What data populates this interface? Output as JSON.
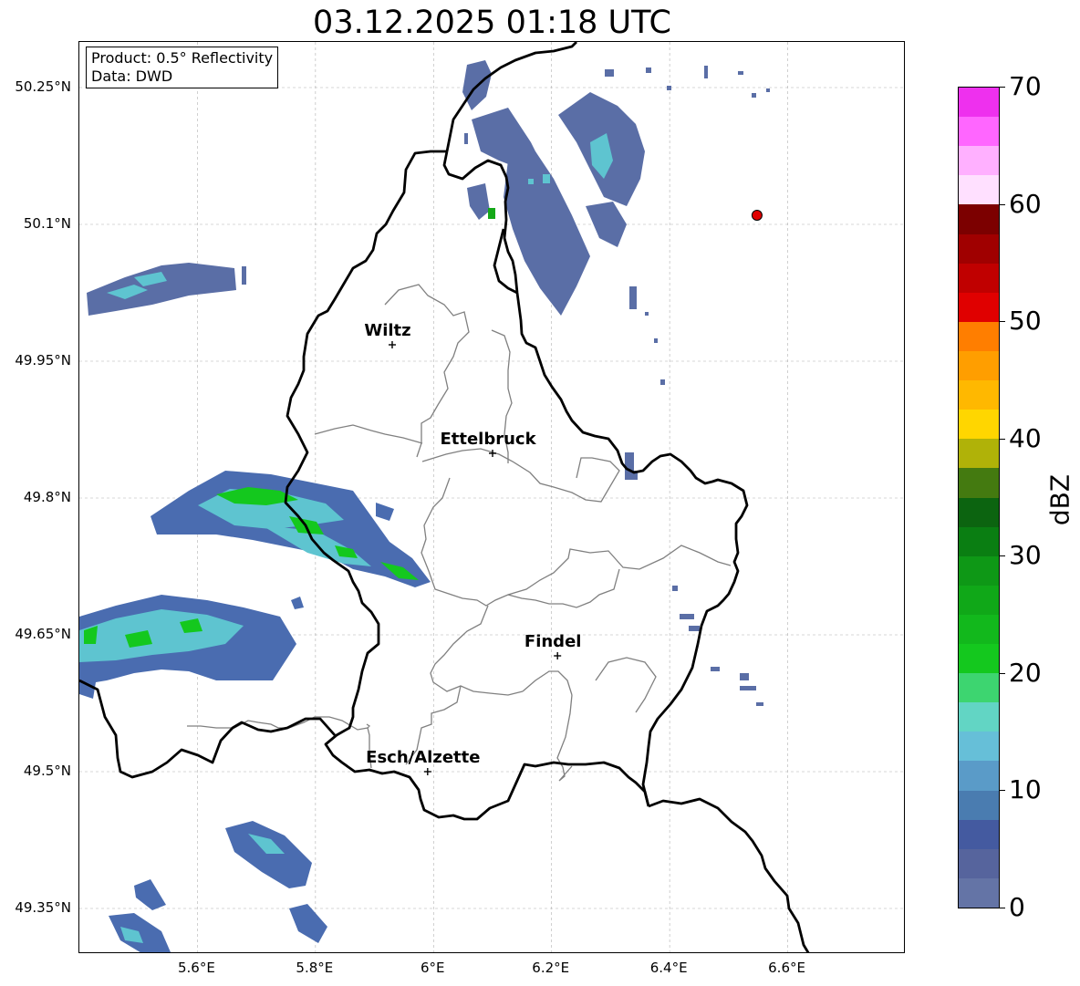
{
  "title": "03.12.2025 01:18 UTC",
  "info": {
    "product": "Product: 0.5° Reflectivity",
    "data": "Data: DWD"
  },
  "map": {
    "lon_range": [
      5.4,
      6.8
    ],
    "lat_range": [
      49.3,
      50.3
    ],
    "lat_ticks": [
      {
        "lat": 50.25,
        "label": "50.25°N"
      },
      {
        "lat": 50.1,
        "label": "50.1°N"
      },
      {
        "lat": 49.95,
        "label": "49.95°N"
      },
      {
        "lat": 49.8,
        "label": "49.8°N"
      },
      {
        "lat": 49.65,
        "label": "49.65°N"
      },
      {
        "lat": 49.5,
        "label": "49.5°N"
      },
      {
        "lat": 49.35,
        "label": "49.35°N"
      }
    ],
    "lon_ticks": [
      {
        "lon": 5.6,
        "label": "5.6°E"
      },
      {
        "lon": 5.8,
        "label": "5.8°E"
      },
      {
        "lon": 6.0,
        "label": "6°E"
      },
      {
        "lon": 6.2,
        "label": "6.2°E"
      },
      {
        "lon": 6.4,
        "label": "6.4°E"
      },
      {
        "lon": 6.6,
        "label": "6.6°E"
      }
    ],
    "cities": [
      {
        "name": "Wiltz",
        "lon": 5.93,
        "lat": 49.968
      },
      {
        "name": "Ettelbruck",
        "lon": 6.1,
        "lat": 49.849
      },
      {
        "name": "Findel",
        "lon": 6.21,
        "lat": 49.627
      },
      {
        "name": "Esch/Alzette",
        "lon": 5.99,
        "lat": 49.5
      }
    ],
    "radar_site": {
      "lon": 6.548,
      "lat": 50.11
    },
    "grid": true
  },
  "colorbar": {
    "label": "dBZ",
    "min": 0,
    "max": 70,
    "step": 2.5,
    "tick_labels": [
      "0",
      "10",
      "20",
      "30",
      "40",
      "50",
      "60",
      "70"
    ],
    "tick_values": [
      0,
      10,
      20,
      30,
      40,
      50,
      60,
      70
    ],
    "colors": [
      "#6474a6",
      "#56649d",
      "#445aa0",
      "#4a7cb0",
      "#5a9bc8",
      "#66bfd8",
      "#62d5c4",
      "#3dd570",
      "#14c81e",
      "#12b81c",
      "#10a818",
      "#0e9816",
      "#0a7e12",
      "#0c6410",
      "#447a10",
      "#b0b208",
      "#ffd600",
      "#ffb800",
      "#ff9e00",
      "#ff7e00",
      "#e00000",
      "#c00000",
      "#a00000",
      "#7c0000",
      "#ffe0ff",
      "#ffb0ff",
      "#ff66ff",
      "#ee30ee"
    ]
  },
  "echo_colors": {
    "light": "#5a6ea6",
    "blue": "#4a6cb0",
    "cyan": "#5ec4d0",
    "green": "#14c81e"
  }
}
